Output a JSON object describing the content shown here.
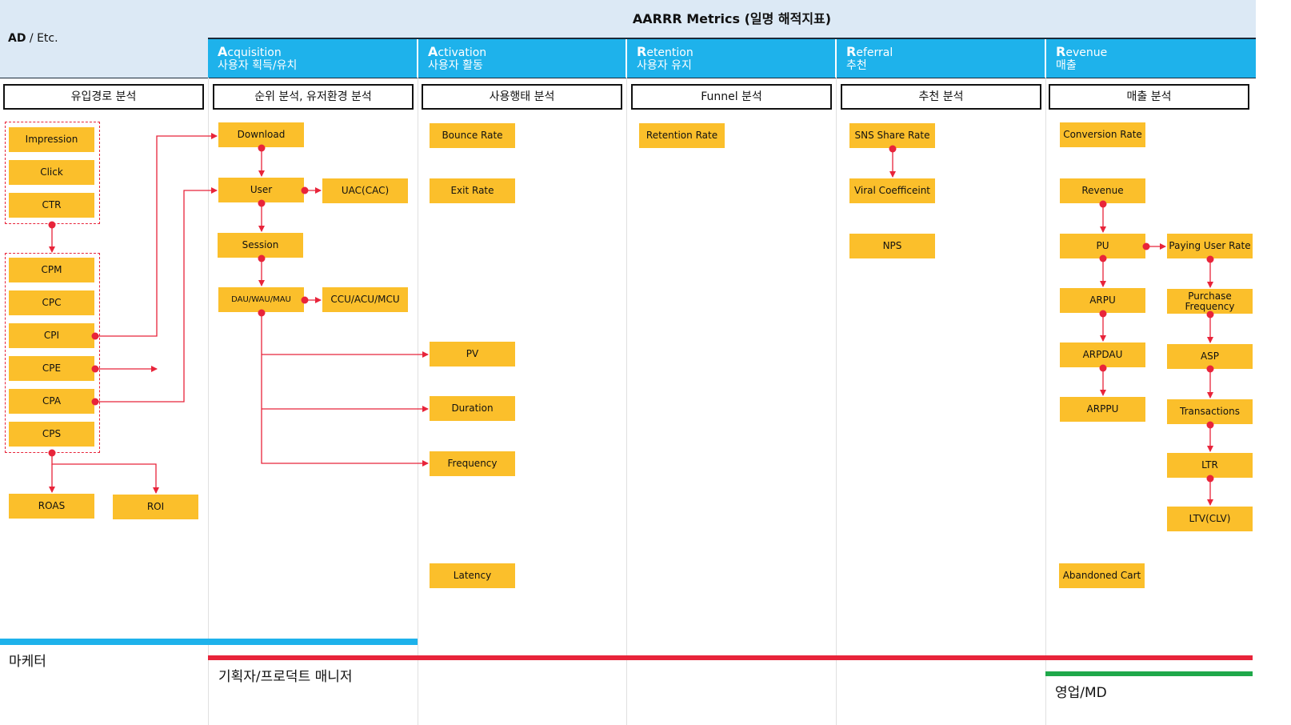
{
  "title": "AARRR Metrics (일명 해적지표)",
  "ad": {
    "strong": "AD",
    "rest": " / Etc."
  },
  "stages": [
    {
      "en": "Acquisition",
      "ko": "사용자 획득/유치"
    },
    {
      "en": "Activation",
      "ko": "사용자 활동"
    },
    {
      "en": "Retention",
      "ko": "사용자 유지"
    },
    {
      "en": "Referral",
      "ko": "추천"
    },
    {
      "en": "Revenue",
      "ko": "매출"
    }
  ],
  "sections": [
    "유입경로 분석",
    "순위 분석, 유저환경 분석",
    "사용행태 분석",
    "Funnel 분석",
    "추천 분석",
    "매출 분석"
  ],
  "metrics": {
    "impression": "Impression",
    "click": "Click",
    "ctr": "CTR",
    "cpm": "CPM",
    "cpc": "CPC",
    "cpi": "CPI",
    "cpe": "CPE",
    "cpa": "CPA",
    "cps": "CPS",
    "roas": "ROAS",
    "roi": "ROI",
    "download": "Download",
    "user": "User",
    "uac": "UAC(CAC)",
    "session": "Session",
    "dau": "DAU/WAU/MAU",
    "ccu": "CCU/ACU/MCU",
    "bounce": "Bounce Rate",
    "exit": "Exit Rate",
    "pv": "PV",
    "duration": "Duration",
    "frequency": "Frequency",
    "latency": "Latency",
    "retention": "Retention Rate",
    "sns": "SNS Share Rate",
    "viral": "Viral Coefficeint",
    "nps": "NPS",
    "conversion": "Conversion Rate",
    "revenue": "Revenue",
    "pu": "PU",
    "arpu": "ARPU",
    "arpdau": "ARPDAU",
    "arppu": "ARPPU",
    "paying": "Paying User Rate",
    "purchase": "Purchase Frequency",
    "asp": "ASP",
    "transactions": "Transactions",
    "ltr": "LTR",
    "ltv": "LTV(CLV)",
    "abandoned": "Abandoned Cart"
  },
  "roles": {
    "marketer": "마케터",
    "planner": "기획자/프로덕트 매니저",
    "sales": "영업/MD"
  },
  "colors": {
    "header_bg": "#dce9f5",
    "stage_bg": "#1eb2eb",
    "box": "#fbbf2b",
    "arrow": "#e8243a",
    "marketer_bar": "#1eb2eb",
    "planner_bar": "#e8243a",
    "sales_bar": "#1fa84a"
  }
}
